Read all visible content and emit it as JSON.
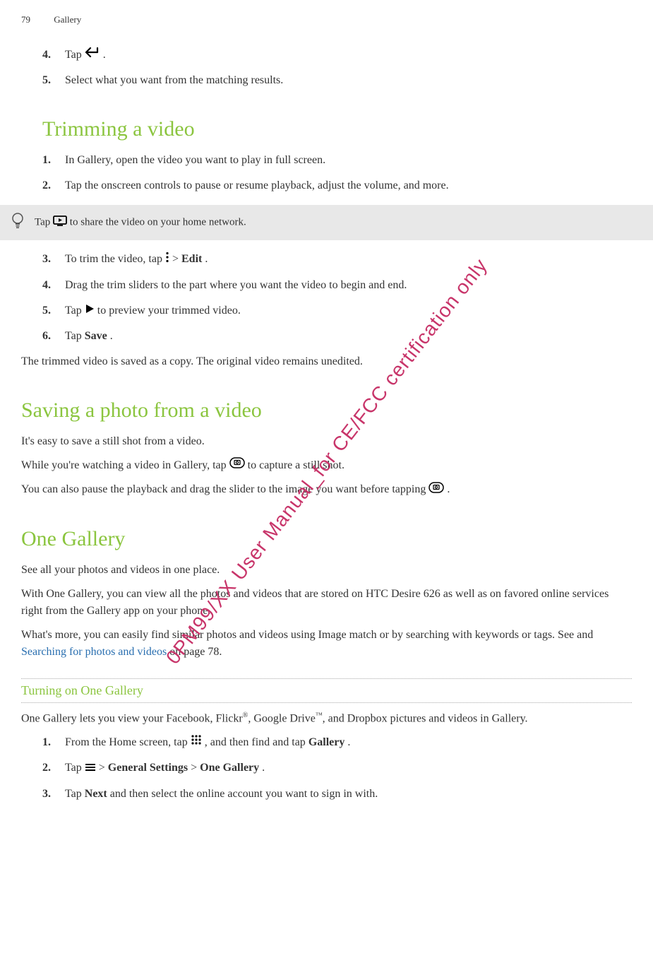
{
  "header": {
    "page_number": "79",
    "section": "Gallery"
  },
  "watermark": "0PM99/XX User Manual_for CE/FCC certification only",
  "intro_steps": {
    "step4_num": "4.",
    "step4_a": "Tap ",
    "step4_b": ".",
    "step5_num": "5.",
    "step5": "Select what you want from the matching results."
  },
  "trimming": {
    "title": "Trimming a video",
    "step1_num": "1.",
    "step1": "In Gallery, open the video you want to play in full screen.",
    "step2_num": "2.",
    "step2": "Tap the onscreen controls to pause or resume playback, adjust the volume, and more.",
    "tip_a": "Tap ",
    "tip_b": " to share the video on your home network.",
    "step3_num": "3.",
    "step3_a": "To trim the video, tap ",
    "step3_b": " > ",
    "step3_edit": "Edit",
    "step3_c": ".",
    "step4_num": "4.",
    "step4": "Drag the trim sliders to the part where you want the video to begin and end.",
    "step5_num": "5.",
    "step5_a": "Tap ",
    "step5_b": " to preview your trimmed video.",
    "step6_num": "6.",
    "step6_a": "Tap ",
    "step6_save": "Save",
    "step6_b": ".",
    "note": "The trimmed video is saved as a copy. The original video remains unedited."
  },
  "saving": {
    "title": "Saving a photo from a video",
    "p1": "It's easy to save a still shot from a video.",
    "p2_a": "While you're watching a video in Gallery, tap ",
    "p2_b": " to capture a still shot.",
    "p3_a": "You can also pause the playback and drag the slider to the image you want before tapping ",
    "p3_b": "."
  },
  "onegallery": {
    "title": "One Gallery",
    "p1": "See all your photos and videos in one place.",
    "p2": "With One Gallery, you can view all the photos and videos that are stored on HTC Desire 626 as well as on favored online services right from the Gallery app on your phone.",
    "p3_a": "What's more, you can easily find similar photos and videos using Image match or by searching with keywords or tags. See and ",
    "p3_link": "Searching for photos and videos",
    "p3_b": " on page 78.",
    "sub_title": "Turning on One Gallery",
    "p4_a": "One Gallery lets you view your Facebook, Flickr",
    "p4_r": "®",
    "p4_b": ", Google Drive",
    "p4_tm": "™",
    "p4_c": ", and Dropbox pictures and videos in Gallery.",
    "step1_num": "1.",
    "step1_a": "From the Home screen, tap ",
    "step1_b": " , and then find and tap ",
    "step1_gallery": "Gallery",
    "step1_c": ".",
    "step2_num": "2.",
    "step2_a": "Tap ",
    "step2_b": " > ",
    "step2_gs": "General Settings",
    "step2_c": " > ",
    "step2_og": "One Gallery",
    "step2_d": ".",
    "step3_num": "3.",
    "step3_a": "Tap ",
    "step3_next": "Next",
    "step3_b": " and then select the online account you want to sign in with."
  }
}
